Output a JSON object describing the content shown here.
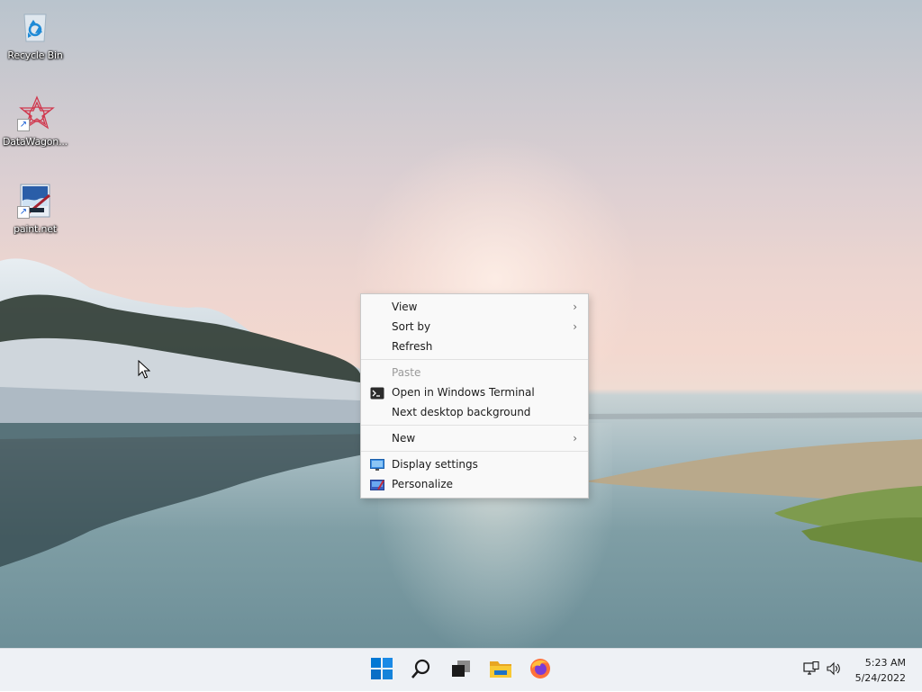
{
  "desktop": {
    "icons": [
      {
        "label": "Recycle Bin",
        "icon": "recycle-bin-icon"
      },
      {
        "label": "DataWagon...",
        "icon": "datawagon-icon"
      },
      {
        "label": "paint.net",
        "icon": "paint-net-icon"
      }
    ]
  },
  "context_menu": {
    "view": "View",
    "sort_by": "Sort by",
    "refresh": "Refresh",
    "paste": "Paste",
    "open_terminal": "Open in Windows Terminal",
    "next_background": "Next desktop background",
    "new": "New",
    "display_settings": "Display settings",
    "personalize": "Personalize",
    "chevron": "›"
  },
  "taskbar": {
    "apps": [
      "start-icon",
      "search-icon",
      "task-view-icon",
      "file-explorer-icon",
      "firefox-icon"
    ],
    "time": "5:23 AM",
    "date": "5/24/2022"
  },
  "colors": {
    "start_blue": "#0078d4",
    "menu_bg": "#f9f9f9",
    "taskbar_bg": "#eef1f5"
  }
}
